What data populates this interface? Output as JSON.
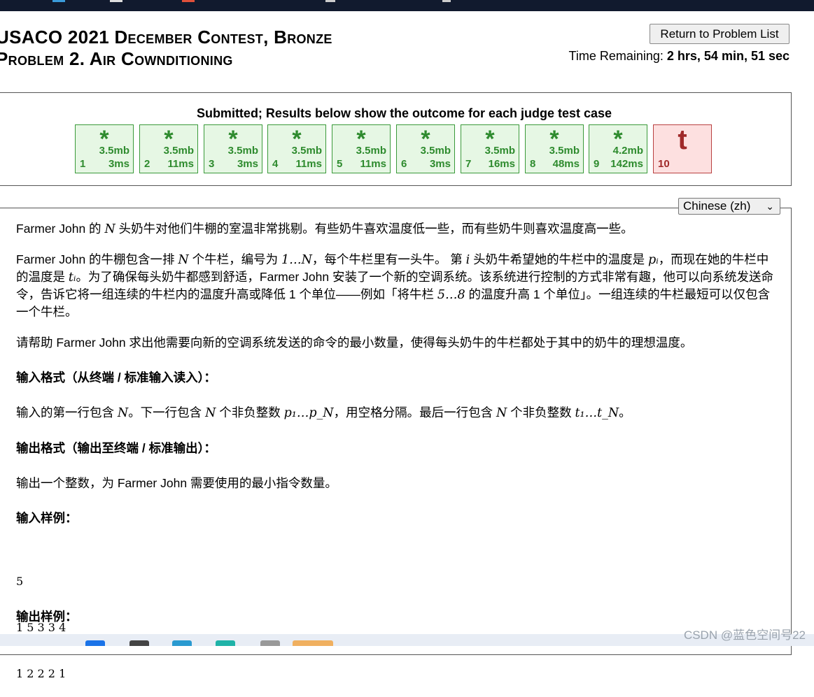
{
  "header": {
    "title_line1": "USACO 2021 December Contest, Bronze",
    "title_line2": "Problem 2. Air Cownditioning",
    "return_button": "Return to Problem List",
    "time_label": "Time Remaining: ",
    "time_value": "2 hrs, 54 min, 51 sec"
  },
  "results": {
    "title": "Submitted; Results below show the outcome for each judge test case",
    "cases": [
      {
        "symbol": "*",
        "memory": "3.5mb",
        "number": "1",
        "time": "3ms",
        "status": "pass"
      },
      {
        "symbol": "*",
        "memory": "3.5mb",
        "number": "2",
        "time": "11ms",
        "status": "pass"
      },
      {
        "symbol": "*",
        "memory": "3.5mb",
        "number": "3",
        "time": "3ms",
        "status": "pass"
      },
      {
        "symbol": "*",
        "memory": "3.5mb",
        "number": "4",
        "time": "11ms",
        "status": "pass"
      },
      {
        "symbol": "*",
        "memory": "3.5mb",
        "number": "5",
        "time": "11ms",
        "status": "pass"
      },
      {
        "symbol": "*",
        "memory": "3.5mb",
        "number": "6",
        "time": "3ms",
        "status": "pass"
      },
      {
        "symbol": "*",
        "memory": "3.5mb",
        "number": "7",
        "time": "16ms",
        "status": "pass"
      },
      {
        "symbol": "*",
        "memory": "3.5mb",
        "number": "8",
        "time": "48ms",
        "status": "pass"
      },
      {
        "symbol": "*",
        "memory": "4.2mb",
        "number": "9",
        "time": "142ms",
        "status": "pass"
      },
      {
        "symbol": "t",
        "memory": "",
        "number": "10",
        "time": "",
        "status": "timeout"
      }
    ]
  },
  "language": {
    "selected": "Chinese (zh)"
  },
  "problem": {
    "p1": {
      "a": "Farmer John 的 ",
      "m1": "N",
      "b": " 头奶牛对他们牛棚的室温非常挑剔。有些奶牛喜欢温度低一些，而有些奶牛则喜欢温度高一些。"
    },
    "p2": {
      "a": "Farmer John 的牛棚包含一排 ",
      "m1": "N",
      "b": " 个牛栏，编号为 ",
      "m2": "1…N",
      "c": "，每个牛栏里有一头牛。 第 ",
      "m3": "i",
      "d": " 头奶牛希望她的牛栏中的温度是 ",
      "m4": "pᵢ",
      "e": "，而现在她的牛栏中的温度是 ",
      "m5": "tᵢ",
      "f": "。为了确保每头奶牛都感到舒适，Farmer John 安装了一个新的空调系统。该系统进行控制的方式非常有趣，他可以向系统发送命令，告诉它将一组连续的牛栏内的温度升高或降低 1 个单位——例如「将牛栏 ",
      "m6": "5…8",
      "g": " 的温度升高 1 个单位」。一组连续的牛栏最短可以仅包含一个牛栏。"
    },
    "p3": "请帮助 Farmer John 求出他需要向新的空调系统发送的命令的最小数量，使得每头奶牛的牛栏都处于其中的奶牛的理想温度。",
    "input_heading": "输入格式（从终端 / 标准输入读入）：",
    "p4": {
      "a": "输入的第一行包含 ",
      "m1": "N",
      "b": "。下一行包含 ",
      "m2": "N",
      "c": " 个非负整数 ",
      "m3": "p₁…p_N",
      "d": "，用空格分隔。最后一行包含 ",
      "m4": "N",
      "e": " 个非负整数 ",
      "m5": "t₁…t_N",
      "f": "。"
    },
    "output_heading": "输出格式（输出至终端 / 标准输出）：",
    "p5": "输出一个整数，为 Farmer John 需要使用的最小指令数量。",
    "sample_input_heading": "输入样例：",
    "sample_input": [
      "5",
      "1 5 3 3 4",
      "1 2 2 2 1"
    ],
    "sample_output_heading": "输出样例："
  },
  "watermark": "CSDN @蓝色空间号22",
  "colors": {
    "pass": "#2e8b2e",
    "fail": "#a02a2a",
    "topbar": "#111a2e"
  }
}
